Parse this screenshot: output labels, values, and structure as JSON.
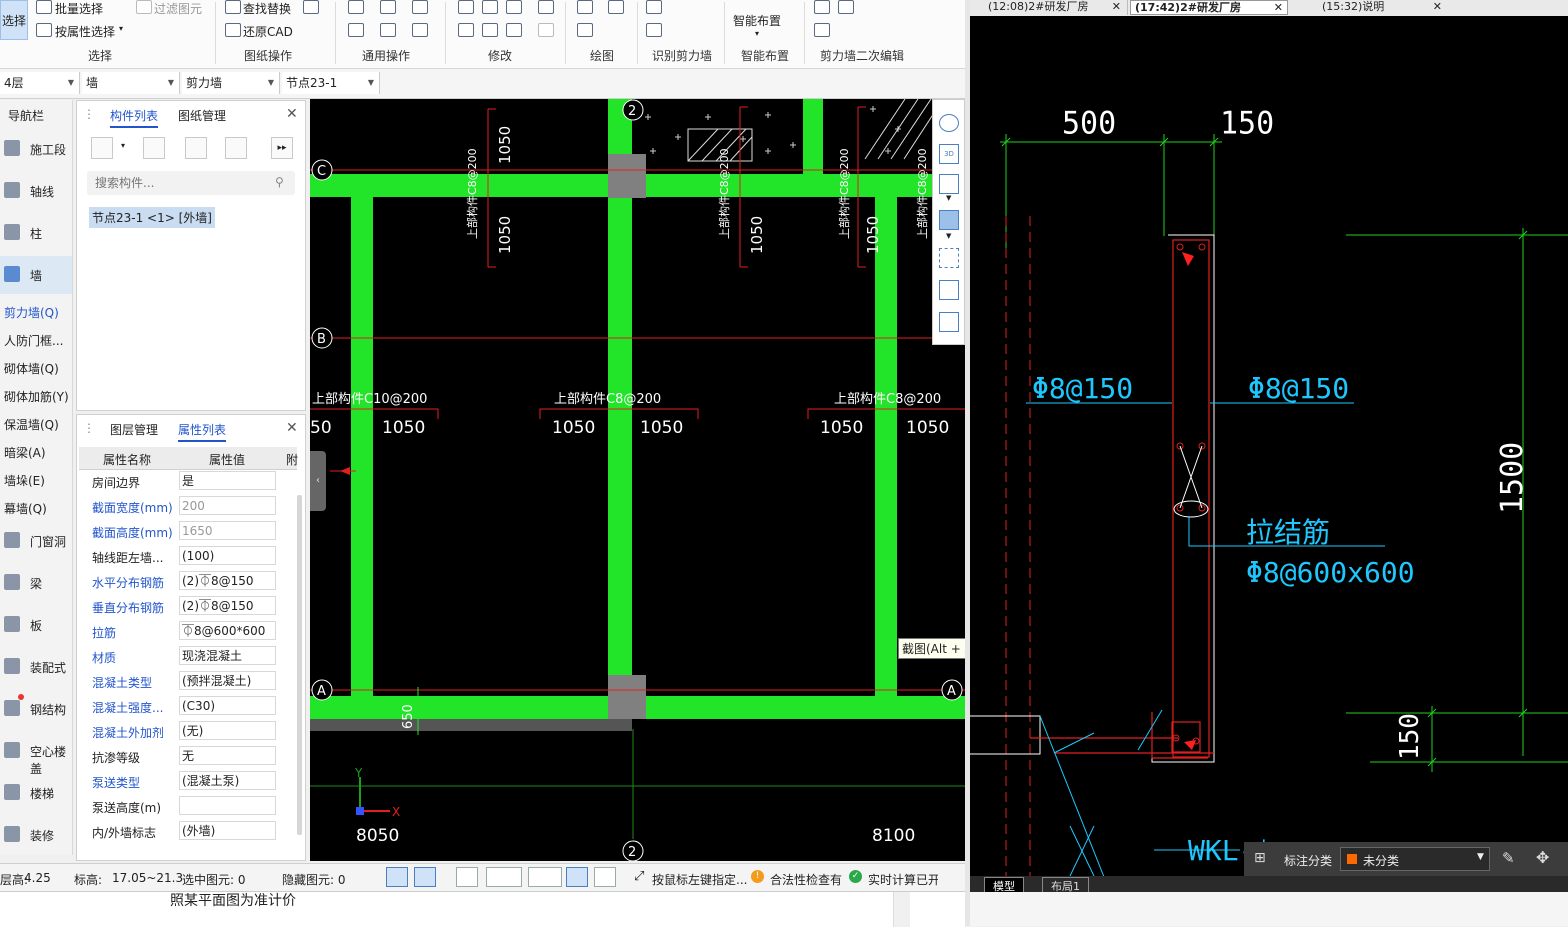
{
  "ribbon": {
    "select_btn": "选择",
    "batch_select": "批量选择",
    "filter_element": "过滤图元",
    "attr_select": "按属性选择",
    "find_replace": "查找替换",
    "restore_cad": "还原CAD",
    "smart_layout": "智能布置",
    "groups": [
      "选择",
      "图纸操作",
      "通用操作",
      "修改",
      "绘图",
      "识别剪力墙",
      "智能布置",
      "剪力墙二次编辑"
    ]
  },
  "toolbar": {
    "floor": "4层",
    "category": "墙",
    "type": "剪力墙",
    "component": "节点23-1"
  },
  "nav": {
    "title": "导航栏",
    "items": [
      "施工段",
      "轴线",
      "柱",
      "墙",
      "门窗洞",
      "梁",
      "板",
      "装配式",
      "钢结构",
      "空心楼盖",
      "楼梯",
      "装修"
    ],
    "wall_sub": [
      "剪力墙(Q)",
      "人防门框...",
      "砌体墙(Q)",
      "砌体加筋(Y)",
      "保温墙(Q)",
      "暗梁(A)",
      "墙垛(E)",
      "幕墙(Q)"
    ]
  },
  "component_panel": {
    "tabs": [
      "构件列表",
      "图纸管理"
    ],
    "search_placeholder": "搜索构件...",
    "selected_item": "节点23-1 <1> [外墙]"
  },
  "property_panel": {
    "tabs": [
      "图层管理",
      "属性列表"
    ],
    "headers": [
      "属性名称",
      "属性值",
      "附"
    ],
    "rows": [
      {
        "name": "房间边界",
        "value": "是"
      },
      {
        "name": "截面宽度(mm)",
        "value": "200"
      },
      {
        "name": "截面高度(mm)",
        "value": "1650"
      },
      {
        "name": "轴线距左墙...",
        "value": "(100)"
      },
      {
        "name": "水平分布钢筋",
        "value": "(2)⏁8@150"
      },
      {
        "name": "垂直分布钢筋",
        "value": "(2)⏁8@150"
      },
      {
        "name": "拉筋",
        "value": "⏁8@600*600"
      },
      {
        "name": "材质",
        "value": "现浇混凝土"
      },
      {
        "name": "混凝土类型",
        "value": "(预拌混凝土)"
      },
      {
        "name": "混凝土强度...",
        "value": "(C30)"
      },
      {
        "name": "混凝土外加剂",
        "value": "(无)"
      },
      {
        "name": "抗渗等级",
        "value": "无"
      },
      {
        "name": "泵送类型",
        "value": "(混凝土泵)"
      },
      {
        "name": "泵送高度(m)",
        "value": ""
      },
      {
        "name": "内/外墙标志",
        "value": "(外墙)"
      }
    ]
  },
  "cad_left": {
    "axes": {
      "c": "C",
      "b": "B",
      "a": "A",
      "col2": "2"
    },
    "dims": {
      "d1050": "1050",
      "d50": "50",
      "d650": "650",
      "d8050": "8050",
      "d8100": "8100"
    },
    "wall_tag": "上部构件C8@200",
    "wall_tag2": "上部构件C10@200",
    "ucs_x": "X",
    "ucs_y": "Y",
    "tooltip": "截图(Alt + A)"
  },
  "status": {
    "floor_height_label": "层高:",
    "floor_height": "4.25",
    "elevation_label": "标高:",
    "elevation": "17.05~21.3",
    "selected": "选中图元: 0",
    "hidden": "隐藏图元: 0",
    "hint": "按鼠标左键指定...",
    "legality": "合法性检查有",
    "realtime": "实时计算已开"
  },
  "right_window": {
    "tabs": [
      "(12:08)2#研发厂房",
      "(17:42)2#研发厂房",
      "(15:32)说明"
    ],
    "dim_500": "500",
    "dim_150": "150",
    "dim_1500": "1500",
    "dim_150b": "150",
    "rebar_left": "Φ8@150",
    "rebar_right": "Φ8@150",
    "tie_label": "拉结筋",
    "tie_spec": "Φ8@600x600",
    "wkl": "WKL-*",
    "classify_label": "标注分类",
    "classify_value": "未分类",
    "bottom_tabs": [
      "模型",
      "布局1"
    ]
  },
  "bottom_text": "照某平面图为准计价",
  "colors": {
    "wall": "#22e52a",
    "axis": "#e02020",
    "cyan": "#1ec8ff",
    "green_line": "#20d020"
  }
}
